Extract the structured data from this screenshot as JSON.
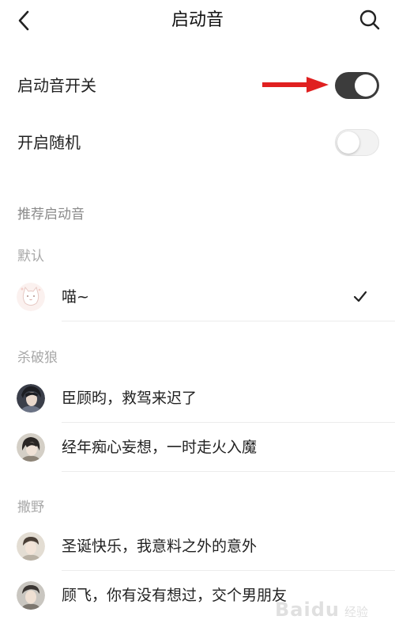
{
  "header": {
    "title": "启动音",
    "back_icon": "chevron-left-icon",
    "search_icon": "search-icon"
  },
  "settings": {
    "sound_switch": {
      "label": "启动音开关",
      "state": "on"
    },
    "random_switch": {
      "label": "开启随机",
      "state": "off"
    }
  },
  "recommend": {
    "section_title": "推荐启动音",
    "groups": [
      {
        "title": "默认",
        "items": [
          {
            "label": "喵~",
            "selected": true
          }
        ]
      },
      {
        "title": "杀破狼",
        "items": [
          {
            "label": "臣顾昀，救驾来迟了",
            "selected": false
          },
          {
            "label": "经年痴心妄想，一时走火入魔",
            "selected": false
          }
        ]
      },
      {
        "title": "撒野",
        "items": [
          {
            "label": "圣诞快乐，我意料之外的意外",
            "selected": false
          },
          {
            "label": "顾飞，你有没有想过，交个男朋友",
            "selected": false
          }
        ]
      }
    ]
  },
  "watermark": {
    "brand": "Baidu",
    "sub": "经验"
  },
  "colors": {
    "toggle_on": "#3c3c3c",
    "toggle_off": "#f2f2f2",
    "annotation_arrow": "#e02020",
    "section_text": "#8a8a8a",
    "group_text": "#a8a8a8"
  }
}
